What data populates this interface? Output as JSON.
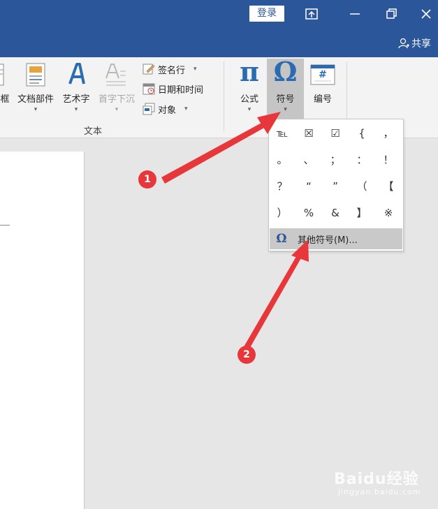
{
  "titlebar": {
    "login_label": "登录",
    "share_label": "共享"
  },
  "ribbon": {
    "left_items": [
      {
        "label": "框"
      },
      {
        "label": "文档部件"
      },
      {
        "label": "艺术字"
      },
      {
        "label": "首字下沉"
      }
    ],
    "small_items": [
      {
        "label": "签名行"
      },
      {
        "label": "日期和时间"
      },
      {
        "label": "对象"
      }
    ],
    "group_label": "文本",
    "right_items": [
      {
        "label": "公式"
      },
      {
        "label": "符号"
      },
      {
        "label": "编号"
      }
    ],
    "pi_glyph": "π",
    "omega_glyph": "Ω",
    "hash_glyph": "#"
  },
  "symbols": {
    "grid": [
      "℡",
      "☒",
      "☑",
      "{",
      "，",
      "。",
      "、",
      "；",
      "：",
      "！",
      "？",
      "“",
      "”",
      "（",
      "【",
      "）",
      "%",
      "&",
      "】",
      "※"
    ],
    "more_label": "其他符号(M)..."
  },
  "annotations": {
    "badge_1": "1",
    "badge_2": "2"
  },
  "watermark": {
    "main": "Baidu经验",
    "sub": "jingyan.baidu.com"
  },
  "colors": {
    "title_bar": "#2b579a",
    "arrow": "#e8373a",
    "accent_icon": "#2b6cb0"
  }
}
